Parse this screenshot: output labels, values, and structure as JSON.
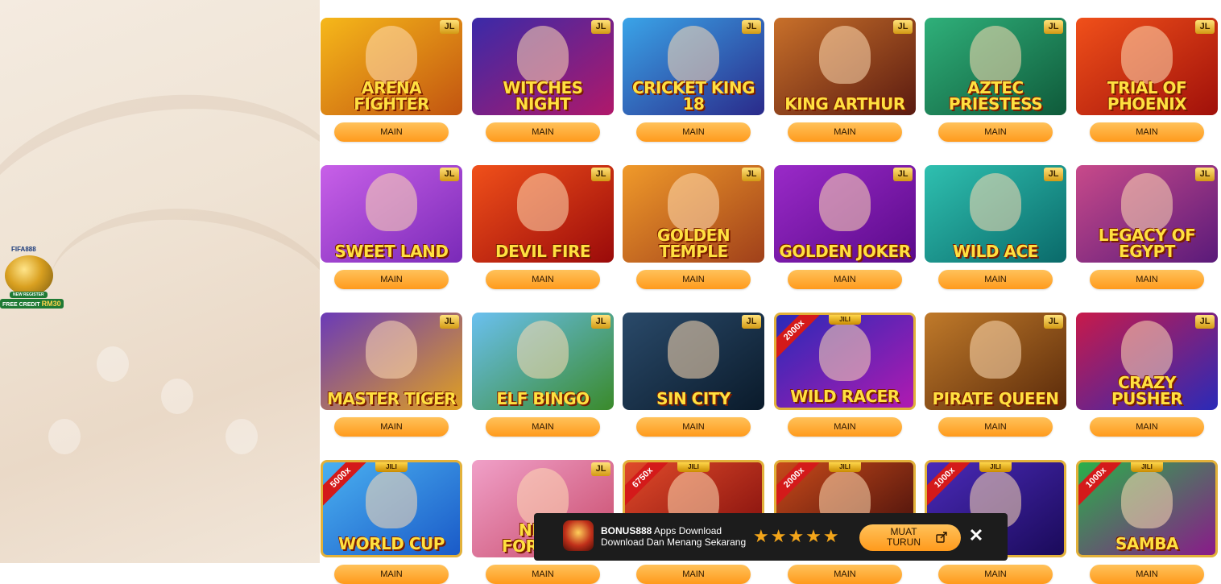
{
  "promo": {
    "brand": "FIFA888",
    "new_register": "NEW REGISTER",
    "free_credit": "FREE CREDIT",
    "amount": "RM30"
  },
  "games": [
    {
      "title": "ARENA FIGHTER",
      "provider": "JL",
      "button": "MAIN",
      "colors": [
        "#f6b81a",
        "#c25410"
      ]
    },
    {
      "title": "WITCHES NIGHT",
      "provider": "JL",
      "button": "MAIN",
      "colors": [
        "#3a2aa8",
        "#b0186a"
      ]
    },
    {
      "title": "CRICKET KING 18",
      "provider": "JL",
      "button": "MAIN",
      "colors": [
        "#3aa4e8",
        "#2a2a8a"
      ]
    },
    {
      "title": "KING ARTHUR",
      "provider": "JL",
      "button": "MAIN",
      "colors": [
        "#c8702a",
        "#5a1a10"
      ]
    },
    {
      "title": "AZTEC PRIESTESS",
      "provider": "JL",
      "button": "MAIN",
      "colors": [
        "#2fb07a",
        "#0f5a3a"
      ]
    },
    {
      "title": "TRIAL OF PHOENIX",
      "provider": "JL",
      "button": "MAIN",
      "colors": [
        "#f0501a",
        "#a0100a"
      ]
    },
    {
      "title": "SWEET LAND",
      "provider": "JL",
      "button": "MAIN",
      "colors": [
        "#c860e8",
        "#7a2ab8"
      ]
    },
    {
      "title": "DEVIL FIRE",
      "provider": "JL",
      "button": "MAIN",
      "colors": [
        "#f0501a",
        "#9a0a0a"
      ]
    },
    {
      "title": "GOLDEN TEMPLE",
      "provider": "JL",
      "button": "MAIN",
      "colors": [
        "#f09a2a",
        "#a0401a"
      ]
    },
    {
      "title": "GOLDEN JOKER",
      "provider": "JL",
      "button": "MAIN",
      "colors": [
        "#9a2ac8",
        "#5a0a8a"
      ]
    },
    {
      "title": "WILD ACE",
      "provider": "JL",
      "button": "MAIN",
      "colors": [
        "#2fc0b0",
        "#0a6a6a"
      ]
    },
    {
      "title": "LEGACY OF EGYPT",
      "provider": "JL",
      "button": "MAIN",
      "colors": [
        "#c84a8a",
        "#5a1a7a"
      ]
    },
    {
      "title": "MASTER TIGER",
      "provider": "JL",
      "button": "MAIN",
      "colors": [
        "#6a3ab8",
        "#e0a020"
      ]
    },
    {
      "title": "ELF BINGO",
      "provider": "JL",
      "button": "MAIN",
      "colors": [
        "#6ac0f0",
        "#3a8a2a"
      ]
    },
    {
      "title": "SIN CITY",
      "provider": "JL",
      "button": "MAIN",
      "colors": [
        "#2a4a6a",
        "#0a1a2a"
      ]
    },
    {
      "title": "WILD RACER",
      "provider": "JILI",
      "button": "MAIN",
      "colors": [
        "#2a2ab8",
        "#b01ab0"
      ],
      "multiplier": "2000x"
    },
    {
      "title": "PIRATE QUEEN",
      "provider": "JL",
      "button": "MAIN",
      "colors": [
        "#c07a2a",
        "#5a2a0a"
      ]
    },
    {
      "title": "CRAZY PUSHER",
      "provider": "JL",
      "button": "MAIN",
      "colors": [
        "#c81a4a",
        "#2a2ab8"
      ]
    },
    {
      "title": "WORLD CUP",
      "provider": "JILI",
      "button": "MAIN",
      "colors": [
        "#4ab0f0",
        "#1a5ac8"
      ],
      "multiplier": "5000x"
    },
    {
      "title": "NEKO FORTUNE",
      "provider": "JL",
      "button": "MAIN",
      "colors": [
        "#f0a0c8",
        "#c84a6a"
      ]
    },
    {
      "title": "",
      "provider": "JILI",
      "button": "MAIN",
      "colors": [
        "#e04a2a",
        "#7a0a0a"
      ],
      "multiplier": "6750x"
    },
    {
      "title": "",
      "provider": "JILI",
      "button": "MAIN",
      "colors": [
        "#c84a1a",
        "#3a0a0a"
      ],
      "multiplier": "2000x"
    },
    {
      "title": "",
      "provider": "JILI",
      "button": "MAIN",
      "colors": [
        "#4a2ab8",
        "#1a0a5a"
      ],
      "multiplier": "1000x"
    },
    {
      "title": "SAMBA",
      "provider": "JILI",
      "button": "MAIN",
      "colors": [
        "#2ab04a",
        "#8a1a8a"
      ],
      "multiplier": "1000x"
    }
  ],
  "download_bar": {
    "headline_bold": "BONUS888",
    "headline_rest": " Apps Download",
    "subline": "Download Dan Menang Sekarang",
    "stars": "★★★★★",
    "rating": 5,
    "button_label": "MUAT TURUN",
    "close_symbol": "✕"
  }
}
